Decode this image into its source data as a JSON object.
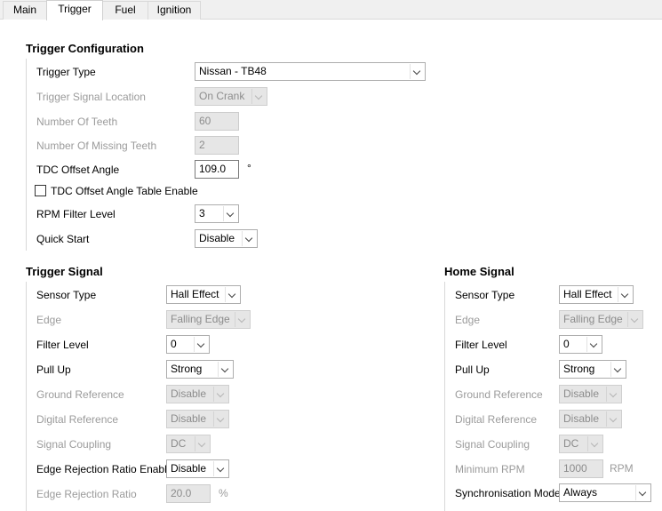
{
  "tabs": [
    "Main",
    "Trigger",
    "Fuel",
    "Ignition"
  ],
  "trigger_config": {
    "title": "Trigger Configuration",
    "trigger_type": {
      "label": "Trigger Type",
      "value": "Nissan - TB48"
    },
    "signal_location": {
      "label": "Trigger Signal Location",
      "value": "On Crank"
    },
    "num_teeth": {
      "label": "Number Of Teeth",
      "value": "60"
    },
    "missing_teeth": {
      "label": "Number Of Missing Teeth",
      "value": "2"
    },
    "tdc_offset": {
      "label": "TDC Offset Angle",
      "value": "109.0",
      "unit": "°"
    },
    "tdc_table_enable": {
      "label": "TDC Offset Angle Table Enable",
      "checked": false
    },
    "rpm_filter": {
      "label": "RPM Filter Level",
      "value": "3"
    },
    "quick_start": {
      "label": "Quick Start",
      "value": "Disable"
    }
  },
  "trigger_signal": {
    "title": "Trigger Signal",
    "sensor_type": {
      "label": "Sensor Type",
      "value": "Hall Effect"
    },
    "edge": {
      "label": "Edge",
      "value": "Falling Edge"
    },
    "filter_level": {
      "label": "Filter Level",
      "value": "0"
    },
    "pull_up": {
      "label": "Pull Up",
      "value": "Strong"
    },
    "ground_ref": {
      "label": "Ground Reference",
      "value": "Disable"
    },
    "digital_ref": {
      "label": "Digital Reference",
      "value": "Disable"
    },
    "coupling": {
      "label": "Signal Coupling",
      "value": "DC"
    },
    "edge_rej_enable": {
      "label": "Edge Rejection Ratio Enable",
      "value": "Disable"
    },
    "edge_rej_ratio": {
      "label": "Edge Rejection Ratio",
      "value": "20.0",
      "unit": "%"
    }
  },
  "home_signal": {
    "title": "Home Signal",
    "sensor_type": {
      "label": "Sensor Type",
      "value": "Hall Effect"
    },
    "edge": {
      "label": "Edge",
      "value": "Falling Edge"
    },
    "filter_level": {
      "label": "Filter Level",
      "value": "0"
    },
    "pull_up": {
      "label": "Pull Up",
      "value": "Strong"
    },
    "ground_ref": {
      "label": "Ground Reference",
      "value": "Disable"
    },
    "digital_ref": {
      "label": "Digital Reference",
      "value": "Disable"
    },
    "coupling": {
      "label": "Signal Coupling",
      "value": "DC"
    },
    "min_rpm": {
      "label": "Minimum RPM",
      "value": "1000",
      "unit": "RPM"
    },
    "sync_mode": {
      "label": "Synchronisation Mode",
      "value": "Always"
    }
  }
}
